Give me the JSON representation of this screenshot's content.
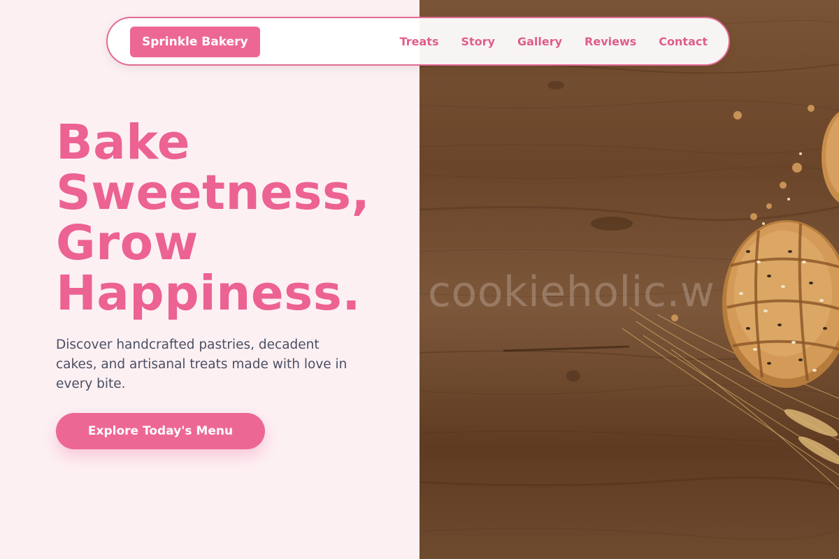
{
  "brand": {
    "name": "Sprinkle Bakery"
  },
  "nav": {
    "links": [
      "Treats",
      "Story",
      "Gallery",
      "Reviews",
      "Contact"
    ]
  },
  "hero": {
    "headline_lines": [
      "Bake",
      "Sweetness,",
      "Grow",
      "Happiness."
    ],
    "subtitle": "Discover handcrafted pastries, decadent cakes, and artisanal treats made with love in every bite.",
    "cta_label": "Explore Today's Menu"
  },
  "image": {
    "watermark": "cookieholic.w"
  },
  "colors": {
    "accent": "#ed6795",
    "page_background": "#fdf0f3",
    "body_text": "#4a4f63"
  }
}
